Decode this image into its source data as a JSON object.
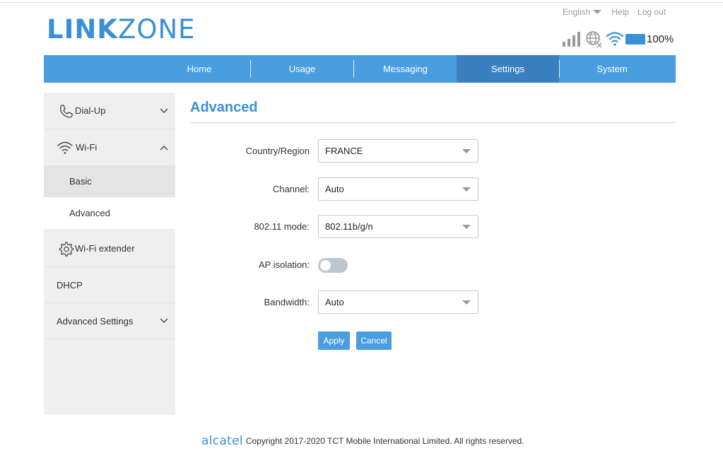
{
  "brand": {
    "logo_bold": "LINK",
    "logo_light": "ZONE",
    "color": "#3a8fd6"
  },
  "top_links": {
    "language": "English",
    "help": "Help",
    "logout": "Log out"
  },
  "status": {
    "signal_icon": "signal-bars-icon",
    "network_icon": "globe-no-internet-icon",
    "wifi_icon": "wifi-icon",
    "battery_icon": "battery-icon",
    "battery_level": "100%"
  },
  "nav": {
    "items": [
      {
        "label": "Home",
        "active": false
      },
      {
        "label": "Usage",
        "active": false
      },
      {
        "label": "Messaging",
        "active": false
      },
      {
        "label": "Settings",
        "active": true
      },
      {
        "label": "System",
        "active": false
      }
    ],
    "color": "#4a9ee0",
    "active_color": "#3a80c0"
  },
  "sidebar": {
    "dialup": {
      "label": "Dial-Up",
      "icon": "phone-icon",
      "expanded": false
    },
    "wifi": {
      "label": "Wi-Fi",
      "icon": "wifi-icon",
      "expanded": true,
      "children": [
        {
          "label": "Basic"
        },
        {
          "label": "Advanced",
          "selected": true
        }
      ]
    },
    "wifi_extender": {
      "label": "Wi-Fi extender",
      "icon": "gear-icon"
    },
    "dhcp": {
      "label": "DHCP"
    },
    "advanced_settings": {
      "label": "Advanced Settings",
      "expanded": false
    }
  },
  "main": {
    "title": "Advanced",
    "fields": {
      "country": {
        "label": "Country/Region",
        "value": "FRANCE"
      },
      "channel": {
        "label": "Channel:",
        "value": "Auto"
      },
      "mode": {
        "label": "802.11 mode:",
        "value": "802.11b/g/n"
      },
      "ap_isolation": {
        "label": "AP isolation:",
        "enabled": false
      },
      "bandwidth": {
        "label": "Bandwidth:",
        "value": "Auto"
      }
    },
    "apply_label": "Apply",
    "cancel_label": "Cancel"
  },
  "footer": {
    "brand": "alcatel",
    "copyright": "Copyright 2017-2020 TCT Mobile International Limited. All rights reserved."
  }
}
